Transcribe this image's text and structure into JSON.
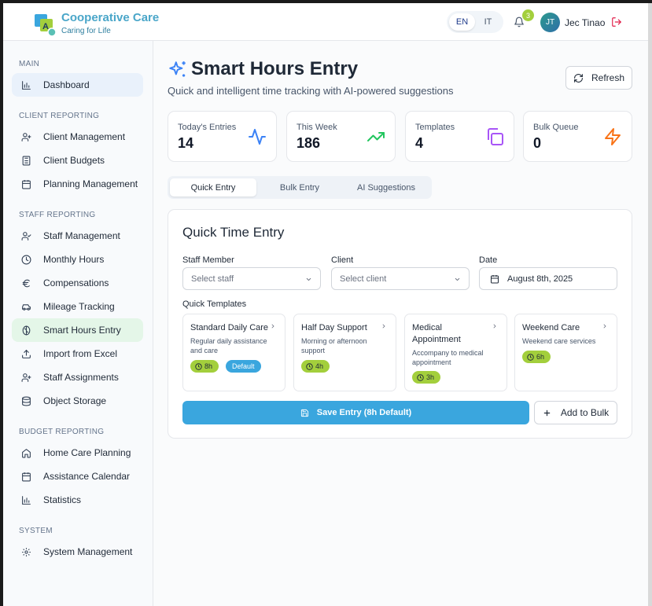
{
  "header": {
    "brand_title": "Cooperative Care",
    "brand_subtitle": "Caring for Life",
    "languages": [
      "EN",
      "IT"
    ],
    "active_language": "EN",
    "notification_count": "3",
    "user_initials": "JT",
    "user_name": "Jec Tinao"
  },
  "sidebar": {
    "sections": [
      {
        "label": "MAIN",
        "items": [
          {
            "label": "Dashboard",
            "icon": "bar-chart-icon",
            "active": true
          }
        ]
      },
      {
        "label": "CLIENT REPORTING",
        "items": [
          {
            "label": "Client Management",
            "icon": "users-icon"
          },
          {
            "label": "Client Budgets",
            "icon": "calculator-icon"
          },
          {
            "label": "Planning Management",
            "icon": "calendar-icon"
          }
        ]
      },
      {
        "label": "STAFF REPORTING",
        "items": [
          {
            "label": "Staff Management",
            "icon": "user-check-icon"
          },
          {
            "label": "Monthly Hours",
            "icon": "clock-icon"
          },
          {
            "label": "Compensations",
            "icon": "euro-icon"
          },
          {
            "label": "Mileage Tracking",
            "icon": "car-icon"
          },
          {
            "label": "Smart Hours Entry",
            "icon": "brain-icon",
            "active": true
          },
          {
            "label": "Import from Excel",
            "icon": "upload-icon"
          },
          {
            "label": "Staff Assignments",
            "icon": "user-plus-icon"
          },
          {
            "label": "Object Storage",
            "icon": "database-icon"
          }
        ]
      },
      {
        "label": "BUDGET REPORTING",
        "items": [
          {
            "label": "Home Care Planning",
            "icon": "home-icon"
          },
          {
            "label": "Assistance Calendar",
            "icon": "calendar-icon"
          },
          {
            "label": "Statistics",
            "icon": "bar-chart-icon"
          }
        ]
      },
      {
        "label": "SYSTEM",
        "items": [
          {
            "label": "System Management",
            "icon": "gear-icon"
          }
        ]
      }
    ]
  },
  "page": {
    "title": "Smart Hours Entry",
    "subtitle": "Quick and intelligent time tracking with AI-powered suggestions",
    "refresh_label": "Refresh"
  },
  "stats": [
    {
      "label": "Today's Entries",
      "value": "14",
      "icon": "activity-icon",
      "color": "#3b82f6"
    },
    {
      "label": "This Week",
      "value": "186",
      "icon": "trending-up-icon",
      "color": "#22c55e"
    },
    {
      "label": "Templates",
      "value": "4",
      "icon": "copy-icon",
      "color": "#a855f7"
    },
    {
      "label": "Bulk Queue",
      "value": "0",
      "icon": "zap-icon",
      "color": "#f97316"
    }
  ],
  "tabs": [
    {
      "label": "Quick Entry",
      "active": true
    },
    {
      "label": "Bulk Entry"
    },
    {
      "label": "AI Suggestions"
    }
  ],
  "quick_entry": {
    "title": "Quick Time Entry",
    "staff_label": "Staff Member",
    "staff_placeholder": "Select staff",
    "client_label": "Client",
    "client_placeholder": "Select client",
    "date_label": "Date",
    "date_value": "August 8th, 2025",
    "templates_label": "Quick Templates",
    "templates": [
      {
        "title": "Standard Daily Care",
        "description": "Regular daily assistance and care",
        "hours": "8h",
        "badge": "Default"
      },
      {
        "title": "Half Day Support",
        "description": "Morning or afternoon support",
        "hours": "4h"
      },
      {
        "title": "Medical Appointment",
        "description": "Accompany to medical appointment",
        "hours": "3h"
      },
      {
        "title": "Weekend Care",
        "description": "Weekend care services",
        "hours": "6h"
      }
    ],
    "save_label": "Save Entry (8h Default)",
    "add_bulk_label": "Add to Bulk"
  },
  "colors": {
    "accent": "#3aa6de",
    "lime": "#a3cf3c",
    "brand": "#4aa6c9"
  }
}
